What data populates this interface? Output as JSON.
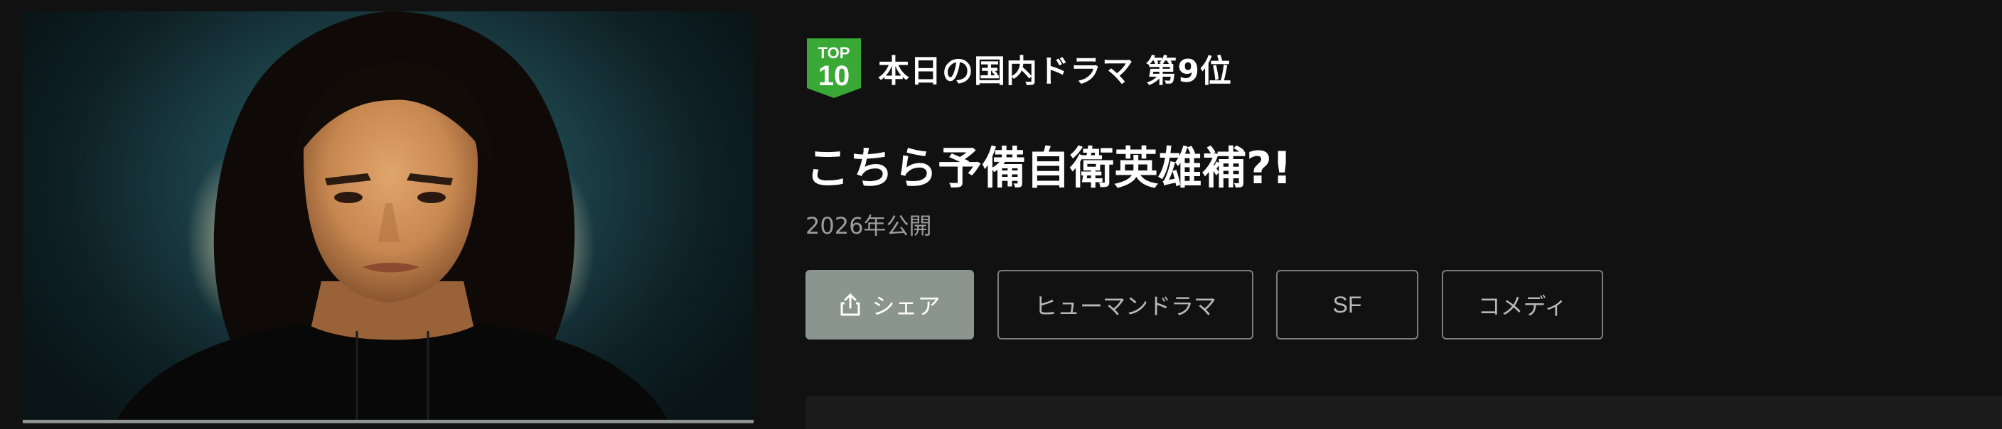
{
  "thumbnail": {
    "alt_icon": "play-thumbnail"
  },
  "ranking": {
    "badge_top": "TOP",
    "badge_number": "10",
    "badge_color": "#3aa834",
    "text": "本日の国内ドラマ 第9位"
  },
  "title": "こちら予備自衛英雄補?!",
  "release": "2026年公開",
  "actions": {
    "share_label": "シェア",
    "share_icon": "share-icon",
    "share_color": "#8a958f"
  },
  "genres": [
    "ヒューマンドラマ",
    "SF",
    "コメディ"
  ]
}
